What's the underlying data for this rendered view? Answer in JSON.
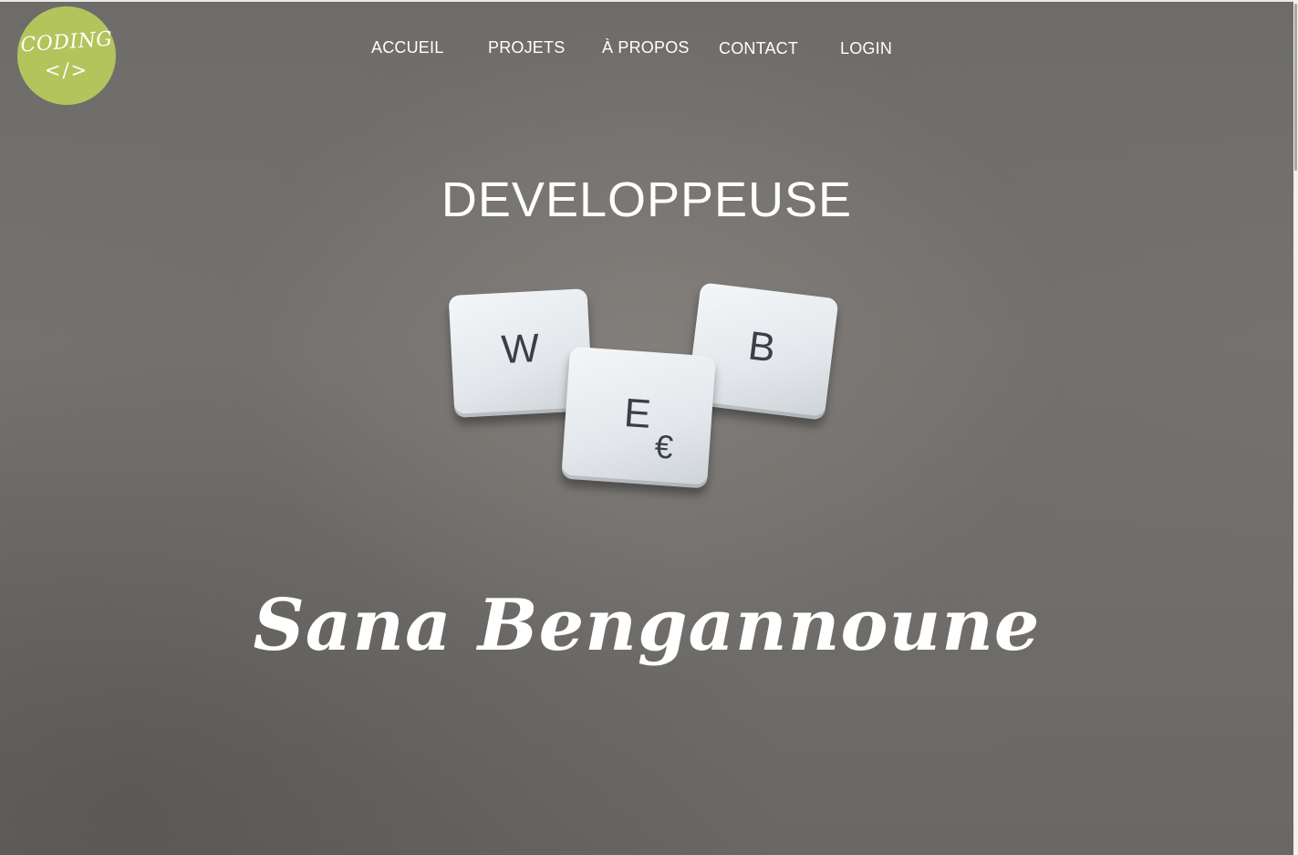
{
  "logo": {
    "word": "CODING",
    "tag": "</>"
  },
  "nav": {
    "items": [
      "ACCUEIL",
      "PROJETS",
      "À PROPOS",
      "CONTACT",
      "LOGIN"
    ]
  },
  "hero": {
    "title": "DEVELOPPEUSE",
    "tiles": {
      "w": "W",
      "e": "E",
      "euro": "€",
      "b": "B"
    },
    "name": "Sana Bengannoune"
  },
  "colors": {
    "logo_bg": "#b3c45c",
    "background": "#6f6c69",
    "text": "#ffffff"
  }
}
